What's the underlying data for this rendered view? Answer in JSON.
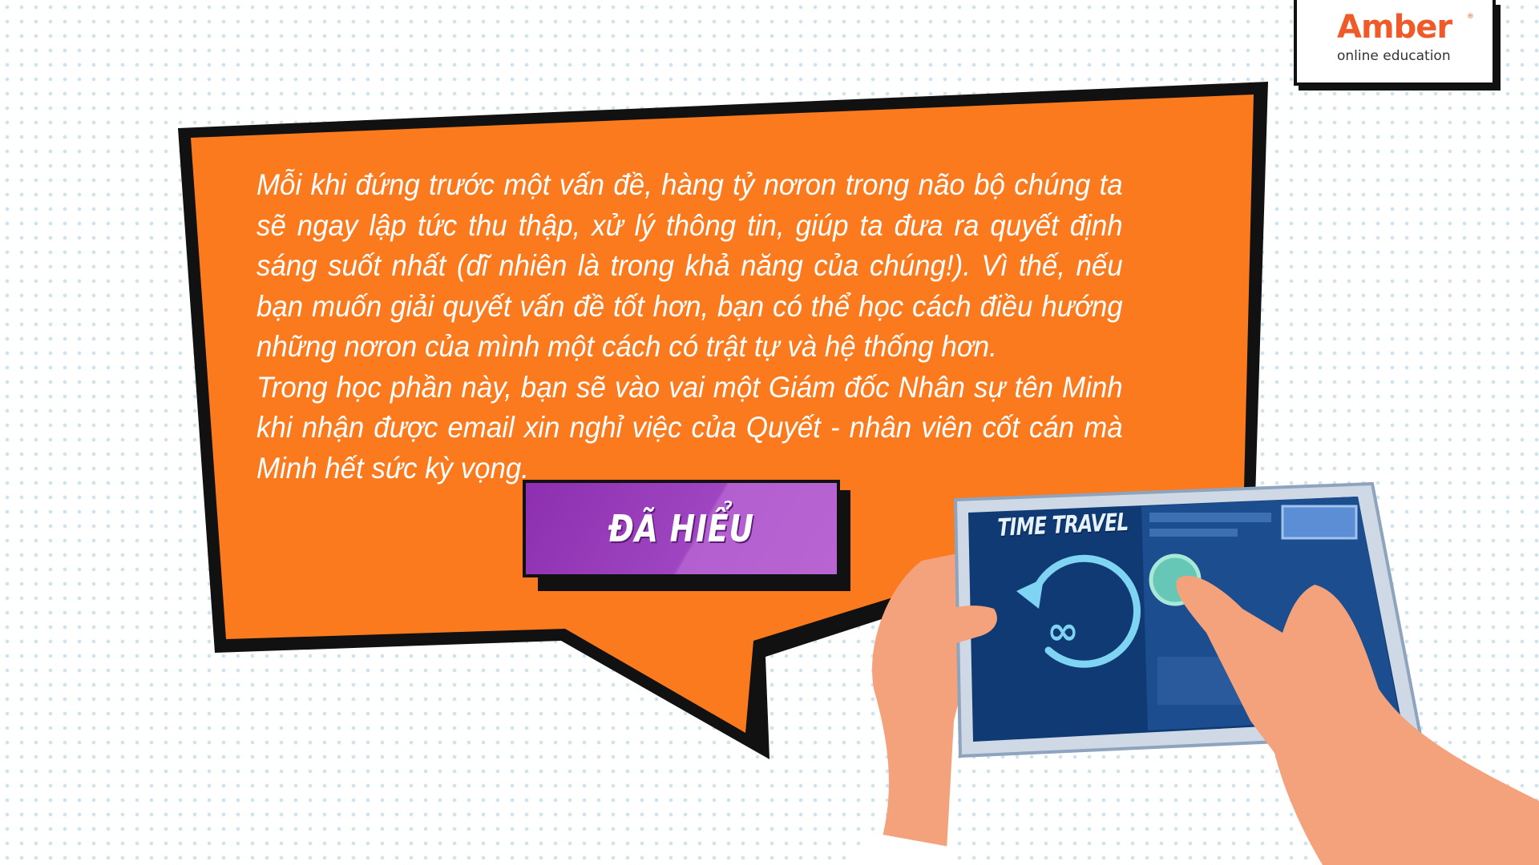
{
  "logo": {
    "wordmark": "Amber",
    "registered": "®",
    "tagline": "online education",
    "brand_color": "#f05a28"
  },
  "bubble": {
    "paragraphs": [
      "Mỗi khi đứng trước một vấn đề, hàng tỷ nơron trong não bộ chúng ta sẽ ngay lập tức thu thập, xử lý thông tin, giúp ta đưa ra quyết định sáng suốt nhất (dĩ nhiên là trong khả năng của chúng!). Vì thế, nếu bạn muốn giải quyết vấn đề tốt hơn, bạn có thể học cách điều hướng những nơron của mình một cách có trật tự và hệ thống hơn.",
      "Trong học phần này, bạn sẽ vào vai một Giám đốc Nhân sự tên Minh khi nhận được email xin nghỉ việc của Quyết - nhân viên cốt cán mà Minh hết sức kỳ vọng."
    ],
    "fill_color": "#fb7a1e"
  },
  "button": {
    "label": "ĐÃ HIỂU",
    "color": "#9f45c1"
  },
  "illustration": {
    "screen_title": "TIME TRAVEL",
    "icon": "infinity-rewind-icon",
    "symbol": "∞"
  }
}
